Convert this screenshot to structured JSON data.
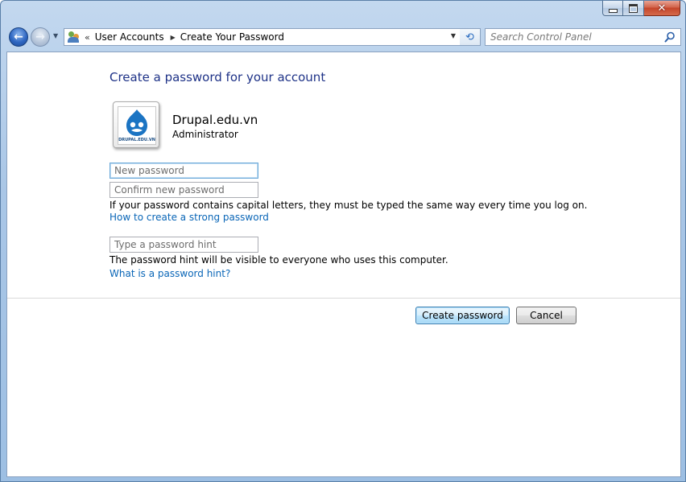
{
  "window": {
    "caption": {
      "minimize_glyph": "",
      "close_glyph": "✕"
    }
  },
  "nav": {
    "back_glyph": "←",
    "forward_glyph": "→",
    "breadcrumb": {
      "chevron": "«",
      "items": [
        "User Accounts",
        "Create Your Password"
      ],
      "separator": "▶"
    },
    "refresh_glyph": "⟲",
    "search": {
      "placeholder": "Search Control Panel",
      "value": ""
    }
  },
  "page": {
    "title": "Create a password for your account",
    "account": {
      "name": "Drupal.edu.vn",
      "role": "Administrator",
      "avatar_label": "DRUPAL.EDU.VN"
    },
    "fields": {
      "new_password": {
        "placeholder": "New password",
        "value": ""
      },
      "confirm_password": {
        "placeholder": "Confirm new password",
        "value": ""
      },
      "password_hint": {
        "placeholder": "Type a password hint",
        "value": ""
      }
    },
    "caps_note": "If your password contains capital letters, they must be typed the same way every time you log on.",
    "strong_password_link": "How to create a strong password",
    "hint_note": "The password hint will be visible to everyone who uses this computer.",
    "hint_link": "What is a password hint?",
    "buttons": {
      "create": "Create password",
      "cancel": "Cancel"
    }
  },
  "colors": {
    "title": "#1e3287",
    "link": "#0a66b7",
    "drupal_blue": "#1b74c3"
  }
}
